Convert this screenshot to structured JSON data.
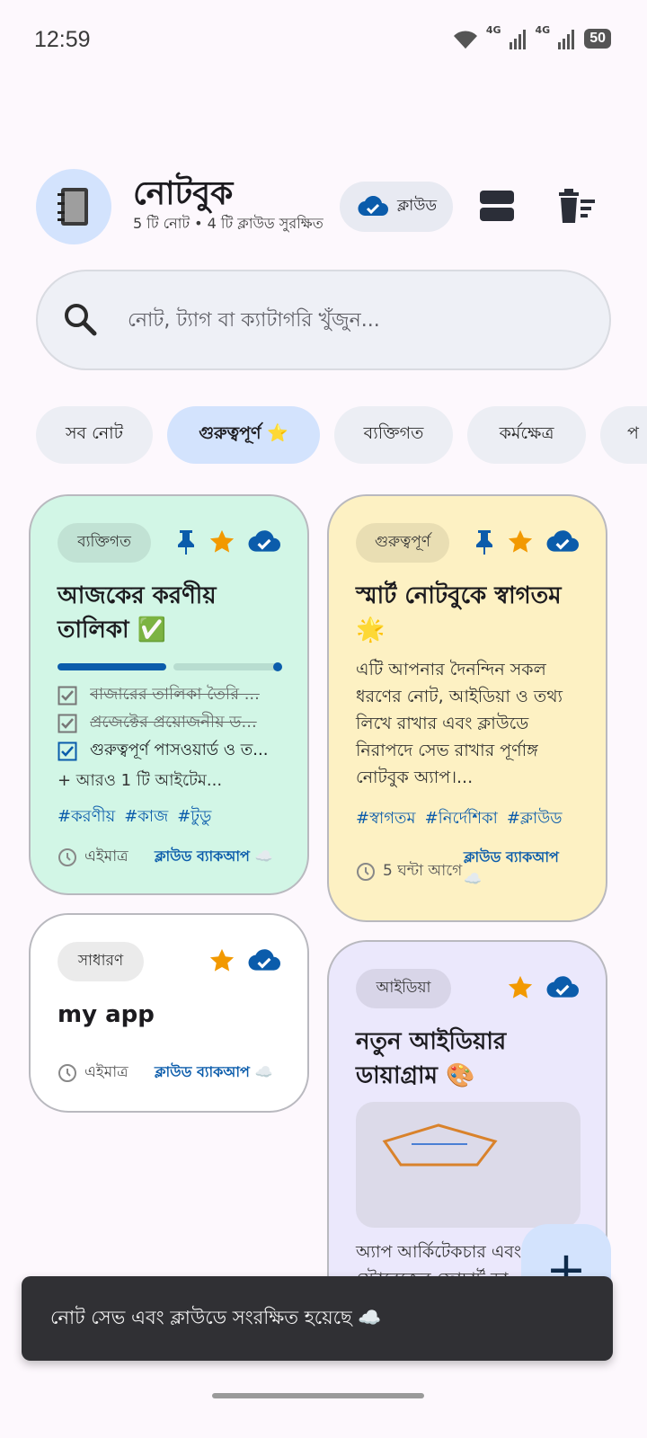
{
  "status_bar": {
    "time": "12:59",
    "network_1": "4G",
    "network_2": "4G",
    "battery": "50"
  },
  "header": {
    "avatar_icon": "notebook-icon",
    "title": "নোটবুক",
    "subtitle": "5 টি নোট • 4 টি ক্লাউড সুরক্ষিত",
    "cloud_chip_label": "ক্লাউড",
    "view_toggle_icon": "grid-view-icon",
    "delete_icon": "delete-sweep-icon"
  },
  "search": {
    "placeholder": "নোট, ট্যাগ বা ক্যাটাগরি খুঁজুন..."
  },
  "filters": [
    {
      "label": "সব নোট",
      "active": false
    },
    {
      "label": "গুরুত্বপূর্ণ ⭐",
      "active": true
    },
    {
      "label": "ব্যক্তিগত",
      "active": false
    },
    {
      "label": "কর্মক্ষেত্র",
      "active": false
    },
    {
      "label": "প",
      "active": false
    }
  ],
  "notes": [
    {
      "category": "ব্যক্তিগত",
      "color": "#d2f6e6",
      "pinned": true,
      "starred": true,
      "synced": true,
      "title_line1": "আজকের করণীয়",
      "title_line2": "তালিকা ✅",
      "progress": 0.5,
      "checklist": [
        {
          "text": "বাজারের তালিকা তৈরি ...",
          "done": true
        },
        {
          "text": "প্রজেক্টের প্রয়োজনীয় ড...",
          "done": true
        },
        {
          "text": "গুরুত্বপূর্ণ পাসওয়ার্ড ও ত...",
          "done": true
        }
      ],
      "more_items": "+ আরও 1 টি আইটেম...",
      "tags": [
        "#করণীয়",
        "#কাজ",
        "#টুডু"
      ],
      "time": "এইমাত্র",
      "backup": "ক্লাউড ব্যাকআপ",
      "backup_glyph": "☁️"
    },
    {
      "category": "গুরুত্বপূর্ণ",
      "color": "#fdf1c3",
      "pinned": true,
      "starred": true,
      "synced": true,
      "title_line1": "স্মার্ট নোটবুকে স্বাগতম",
      "title_line2": "🌟",
      "body_lines": [
        "এটি আপনার দৈনন্দিন সকল",
        "ধরণের নোট, আইডিয়া ও তথ্য",
        "লিখে রাখার এবং ক্লাউডে",
        "নিরাপদে সেভ রাখার পূর্ণাঙ্গ",
        "নোটবুক অ্যাপ।..."
      ],
      "tags": [
        "#স্বাগতম",
        "#নির্দেশিকা",
        "#ক্লাউড"
      ],
      "time": "5 ঘন্টা আগে",
      "backup": "ক্লাউড ব্যাকআপ",
      "backup_glyph": "☁️"
    },
    {
      "category": "সাধারণ",
      "color": "#ffffff",
      "pinned": false,
      "starred": true,
      "synced": true,
      "title_line1": "my app",
      "time": "এইমাত্র",
      "backup": "ক্লাউড ব্যাকআপ",
      "backup_glyph": "☁️"
    },
    {
      "category": "আইডিয়া",
      "color": "#ebe8fc",
      "pinned": false,
      "starred": true,
      "synced": true,
      "title_line1": "নতুন আইডিয়ার",
      "title_line2": "ডায়াগ্রাম 🎨",
      "body_lines": [
        "অ্যাপ আর্কিটেকচার এবং",
        "স্টোরেজের ফ্লোচার্ট ডা"
      ]
    }
  ],
  "fab_label": "+",
  "snackbar": "নোট সেভ এবং ক্লাউডে সংরক্ষিত হয়েছে ☁️",
  "colors": {
    "accent": "#0b5cab",
    "star": "#f29900",
    "chip_active": "#d3e3fd"
  }
}
